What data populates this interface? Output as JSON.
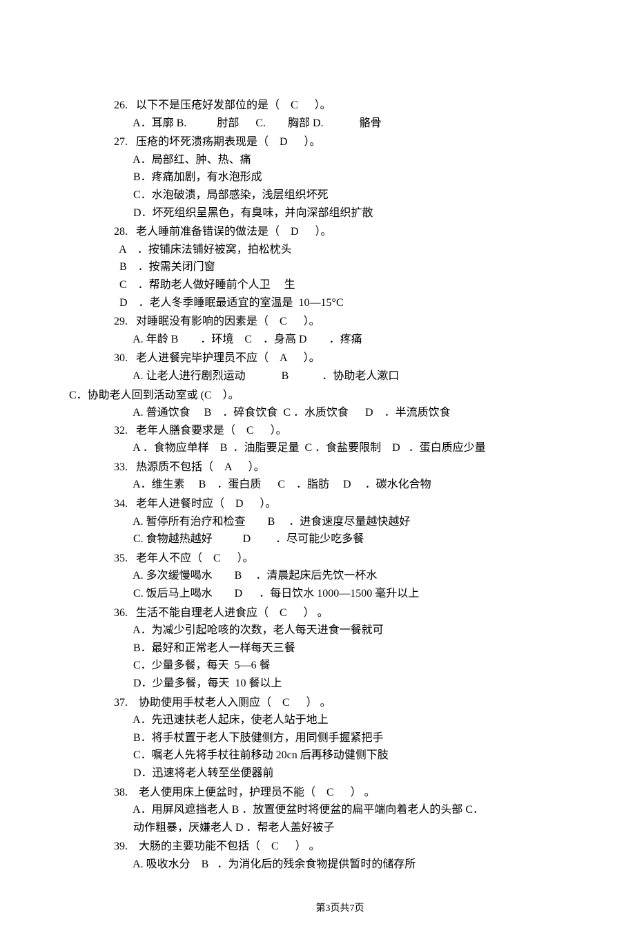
{
  "questions": [
    {
      "num": "26.",
      "stem_pre": "以下不是压疮好发部位的是（",
      "answer": "C",
      "stem_post": "）。",
      "options": [
        "A．耳廓 B.           肘部      C.        胸部 D.             骼骨"
      ]
    },
    {
      "num": "27.",
      "stem_pre": "压疮的坏死溃疡期表现是（",
      "answer": "D",
      "stem_post": "）。",
      "options": [
        "A．局部红、肿、热、痛",
        "B．疼痛加剧，有水泡形成",
        "C．水泡破溃，局部感染，浅层组织坏死",
        "D．坏死组织呈黑色，有臭味，并向深部组织扩散"
      ]
    },
    {
      "num": "28.",
      "stem_pre": "老人睡前准备错误的做法是（",
      "answer": "D",
      "stem_post": "）。",
      "options": [
        "A    ．按铺床法铺好被窝，拍松枕头",
        "B    ．按需关闭门窗",
        "C    ．帮助老人做好睡前个人卫     生",
        "D    ．老人冬季睡眠最适宜的室温是  10—15°C"
      ],
      "opt_indent": "opt-a"
    },
    {
      "num": "29.",
      "stem_pre": "对睡眠没有影响的因素是（",
      "answer": "C",
      "stem_post": "）。",
      "options": [
        "A. 年龄 B        ．环境    C    ．身高 D        ．疼痛"
      ]
    },
    {
      "num": "30.",
      "stem_pre": "老人进餐完毕护理员不应（",
      "answer": "A",
      "stem_post": "）。",
      "options": [
        "A. 让老人进行剧烈运动             B            ．协助老人漱口"
      ],
      "extra_line": "C．协助老人回到活动室或 (C    ）。",
      "extra_options": [
        "A. 普通饮食     B    ．碎食饮食  C ．水质饮食      D    ．半流质饮食"
      ]
    },
    {
      "num": "32.",
      "stem_pre": "老年人膳食要求是（",
      "answer": "C",
      "stem_post": "）。",
      "options": [
        "A ．食物应单样    B  ．油脂要足量  C ．食盐要限制    D   ．蛋白质应少量"
      ]
    },
    {
      "num": "33.",
      "stem_pre": "热源质不包括（",
      "answer": "A",
      "stem_post": "）。",
      "options": [
        "A．维生素     B    ．蛋白质      C    ．脂肪     D     ．碳水化合物"
      ]
    },
    {
      "num": "34.",
      "stem_pre": "老年人进餐时应（",
      "answer": "D",
      "stem_post": "）。",
      "options": [
        "A. 暂停所有治疗和检查        B     ．进食速度尽量越快越好",
        "C. 食物越热越好           D         ．尽可能少吃多餐"
      ]
    },
    {
      "num": "35.",
      "stem_pre": "老年人不应（",
      "answer": "C",
      "stem_post": "）。",
      "options": [
        "A. 多次缓慢喝水        B     ．清晨起床后先饮一杯水",
        "C. 饭后马上喝水        D      ．每日饮水 1000—1500 毫升以上"
      ]
    },
    {
      "num": "36.",
      "stem_pre": "生活不能自理老人进食应（",
      "answer": "C",
      "stem_post": "） 。",
      "options": [
        "A．为减少引起呛咳的次数，老人每天进食一餐就可",
        "B．最好和正常老人一样每天三餐",
        "C．少量多餐，每天  5—6 餐",
        "D．少量多餐，每天  10 餐以上"
      ]
    },
    {
      "num": "37.",
      "stem_pre": " 协助使用手杖老人入厕应（",
      "answer": "C",
      "stem_post": "） 。",
      "options": [
        "A．先迅速扶老人起床，使老人站于地上",
        "B．将手杖置于老人下肢健侧方，用同侧手握紧把手",
        "C．嘱老人先将手杖往前移动 20cn 后再移动健侧下肢",
        "D．迅速将老人转至坐便器前"
      ]
    },
    {
      "num": "38.",
      "stem_pre": " 老人使用床上便盆时，护理员不能（",
      "answer": "C",
      "stem_post": "） 。",
      "options": [
        "A．用屏风遮挡老人 B ．放置便盆时将便盆的扁平端向着老人的头部 C．",
        "动作粗暴，厌嫌老人 D ．帮老人盖好被子"
      ]
    },
    {
      "num": "39.",
      "stem_pre": " 大肠的主要功能不包括（",
      "answer": "C",
      "stem_post": "） 。",
      "options": [
        "A. 吸收水分    B   ．为消化后的残余食物提供暂时的储存所"
      ]
    }
  ],
  "footer": {
    "pre": "第",
    "cur": "3",
    "mid": "页共",
    "total": "7",
    "post": "页"
  }
}
